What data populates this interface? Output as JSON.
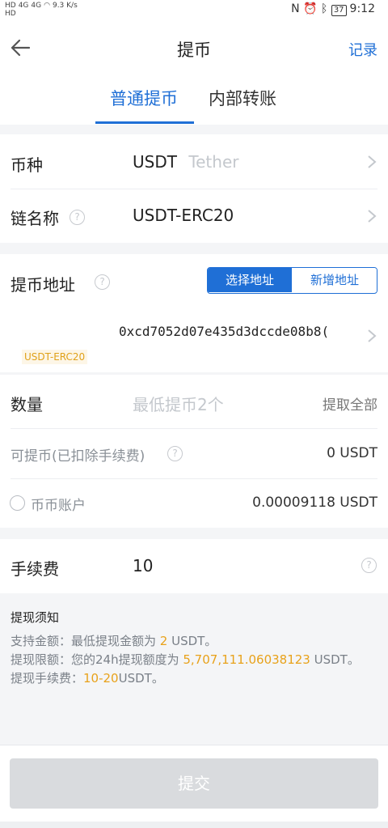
{
  "status_bar": {
    "hd1": "HD",
    "sig1": "4G",
    "sig2": "4G",
    "hd2": "HD",
    "speed": "9.3 K/s",
    "battery": "37",
    "time": "9:12"
  },
  "nav": {
    "title": "提币",
    "record": "记录"
  },
  "tabs": [
    {
      "label": "普通提币",
      "active": true
    },
    {
      "label": "内部转账",
      "active": false
    }
  ],
  "coin": {
    "label": "币种",
    "symbol": "USDT",
    "name": "Tether"
  },
  "chain": {
    "label": "链名称",
    "value": "USDT-ERC20"
  },
  "address": {
    "label": "提币地址",
    "select": "选择地址",
    "add": "新增地址",
    "value": "0xcd7052d07e435d3dccde08b8(",
    "chain_tag": "USDT-ERC20"
  },
  "amount": {
    "label": "数量",
    "placeholder": "最低提币2个",
    "withdraw_all": "提取全部",
    "available_label": "可提币(已扣除手续费)",
    "available_value": "0 USDT",
    "account_label": "币币账户",
    "account_value": "0.00009118 USDT"
  },
  "fee": {
    "label": "手续费",
    "value": "10"
  },
  "notice": {
    "title": "提现须知",
    "l1_a": "支持金额：最低提现金额为 ",
    "l1_hl": "2",
    "l1_b": " USDT。",
    "l2_a": "提现限额：您的24h提现额度为 ",
    "l2_hl": "5,707,111.06038123",
    "l2_b": " USDT。",
    "l3_a": "提现手续费：",
    "l3_hl": "10-20",
    "l3_b": "USDT。"
  },
  "submit": "提交",
  "colors": {
    "accent": "#1f6fd6",
    "highlight": "#e8a21b",
    "disabled": "#d9dbde"
  }
}
